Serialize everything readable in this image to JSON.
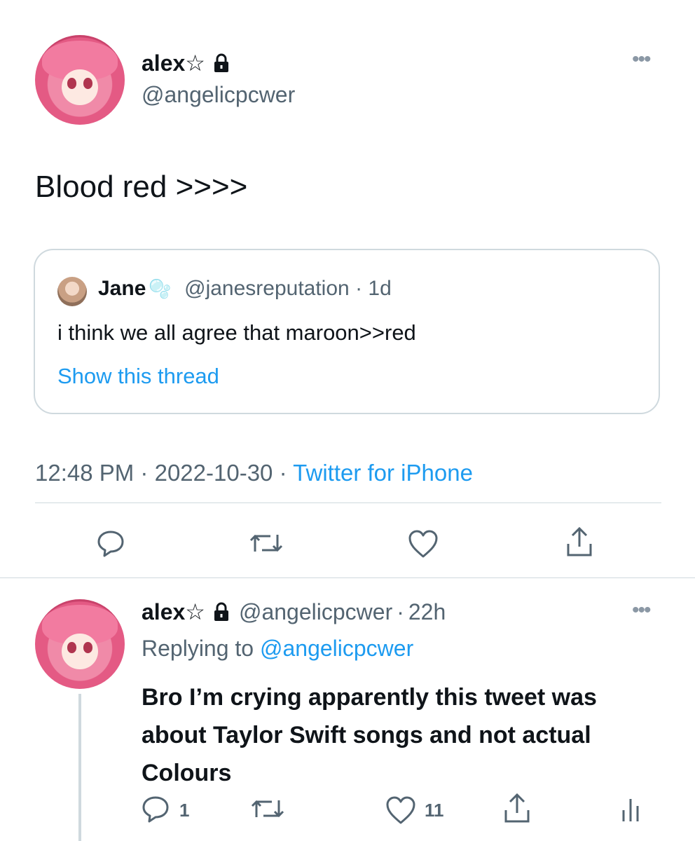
{
  "tweet": {
    "display_name": "alex☆",
    "lock_icon": "lock-icon",
    "handle": "@angelicpcwer",
    "text": "Blood red >>>>",
    "quote": {
      "name": "Jane",
      "emoji": "🫧",
      "handle": "@janesreputation",
      "sep": "·",
      "age": "1d",
      "text": "i think we all agree that maroon>>red",
      "show_thread": "Show this thread"
    },
    "time": "12:48 PM",
    "dot1": "·",
    "date": "2022-10-30",
    "dot2": "·",
    "source": "Twitter for iPhone",
    "actions": [
      "reply-icon",
      "retweet-icon",
      "like-icon",
      "share-icon"
    ]
  },
  "reply": {
    "display_name": "alex☆",
    "handle": "@angelicpcwer",
    "sep": "·",
    "age": "22h",
    "replying_prefix": "Replying to",
    "replying_handle": "@angelicpcwer",
    "text": "Bro I’m crying apparently this tweet was about Taylor Swift songs and not actual Colours",
    "reply_count": "1",
    "like_count": "11",
    "actions": [
      "reply-icon",
      "retweet-icon",
      "like-icon",
      "share-icon",
      "analytics-icon"
    ]
  },
  "colors": {
    "link": "#1d9bf0",
    "text": "#0f1419",
    "muted": "#536471",
    "border": "#cfd9de"
  }
}
